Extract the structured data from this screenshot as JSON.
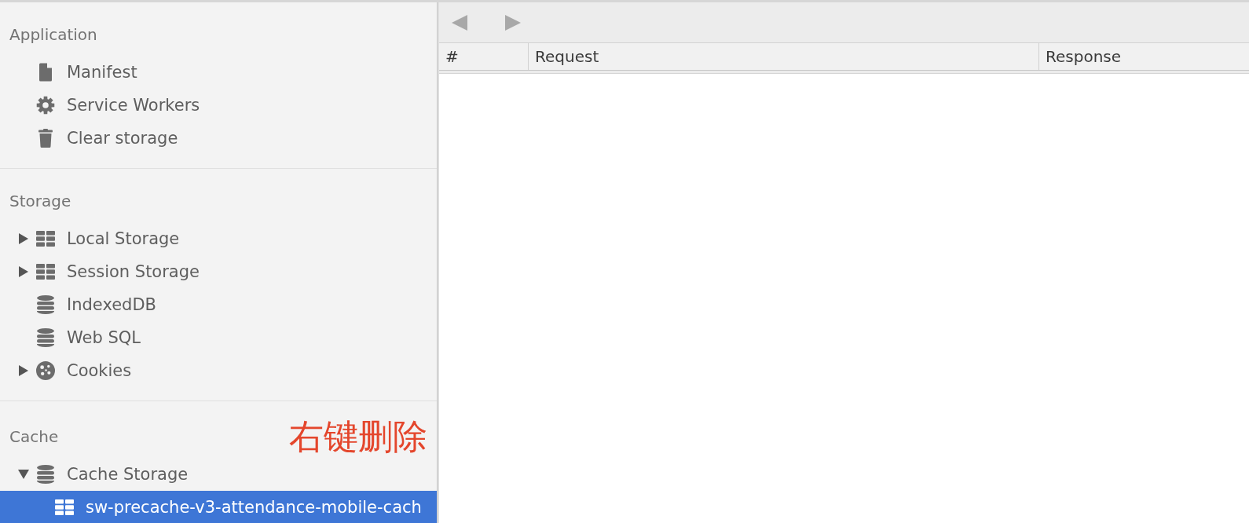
{
  "sidebar": {
    "sections": [
      {
        "title": "Application",
        "items": [
          {
            "label": "Manifest",
            "kind": "file",
            "selected": false
          },
          {
            "label": "Service Workers",
            "kind": "gear",
            "selected": false
          },
          {
            "label": "Clear storage",
            "kind": "trash",
            "selected": false
          }
        ]
      },
      {
        "title": "Storage",
        "items": [
          {
            "label": "Local Storage",
            "kind": "grid",
            "expanded": false,
            "selected": false
          },
          {
            "label": "Session Storage",
            "kind": "grid",
            "expanded": false,
            "selected": false
          },
          {
            "label": "IndexedDB",
            "kind": "database",
            "selected": false
          },
          {
            "label": "Web SQL",
            "kind": "database",
            "selected": false
          },
          {
            "label": "Cookies",
            "kind": "cookie",
            "expanded": false,
            "selected": false
          }
        ]
      },
      {
        "title": "Cache",
        "annotation": "右键删除",
        "items": [
          {
            "label": "Cache Storage",
            "kind": "database",
            "expanded": true,
            "selected": false,
            "children": [
              {
                "label": "sw-precache-v3-attendance-mobile-cach",
                "kind": "grid",
                "selected": true
              }
            ]
          }
        ]
      }
    ]
  },
  "toolbar": {
    "buttons": [
      {
        "kind": "back",
        "disabled": true
      },
      {
        "kind": "forward",
        "disabled": true
      }
    ]
  },
  "table": {
    "columns": [
      "#",
      "Request",
      "Response"
    ]
  }
}
